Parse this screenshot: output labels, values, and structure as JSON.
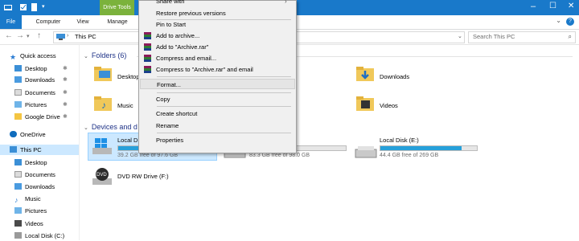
{
  "window": {
    "contextual_tab": "Drive Tools",
    "colors": {
      "accent": "#1979ca",
      "drive_tools": "#7bb23c",
      "selection": "#cce8ff",
      "bar_fill": "#26a0da"
    }
  },
  "ribbon": {
    "tabs": [
      "File",
      "Computer",
      "View",
      "Manage"
    ]
  },
  "nav": {
    "address": "This PC",
    "search_placeholder": "Search This PC"
  },
  "sidebar": {
    "quick_access": "Quick access",
    "items": [
      "Desktop",
      "Downloads",
      "Documents",
      "Pictures",
      "Google Drive"
    ],
    "onedrive": "OneDrive",
    "this_pc": "This PC",
    "pc_items": [
      "Desktop",
      "Documents",
      "Downloads",
      "Music",
      "Pictures",
      "Videos",
      "Local Disk (C:)"
    ]
  },
  "main": {
    "folders_group": "Folders (6)",
    "folders": [
      "Desktop",
      "Downloads",
      "Music",
      "Videos"
    ],
    "devices_group": "Devices and d",
    "drives": [
      {
        "name": "Local D",
        "free": "39.2 GB free of 97.6 GB",
        "used_fraction": 0.6
      },
      {
        "name": "",
        "free": "83.3 GB free of 98.0 GB",
        "used_fraction": 0.15
      },
      {
        "name": "Local Disk (E:)",
        "free": "44.4 GB free of 269 GB",
        "used_fraction": 0.84
      }
    ],
    "dvd": "DVD RW Drive (F:)"
  },
  "context_menu": {
    "items": [
      "Share with",
      "Restore previous versions",
      "Pin to Start",
      "Add to archive...",
      "Add to \"Archive.rar\"",
      "Compress and email...",
      "Compress to \"Archive.rar\" and email",
      "Format...",
      "Copy",
      "Create shortcut",
      "Rename",
      "Properties"
    ]
  }
}
